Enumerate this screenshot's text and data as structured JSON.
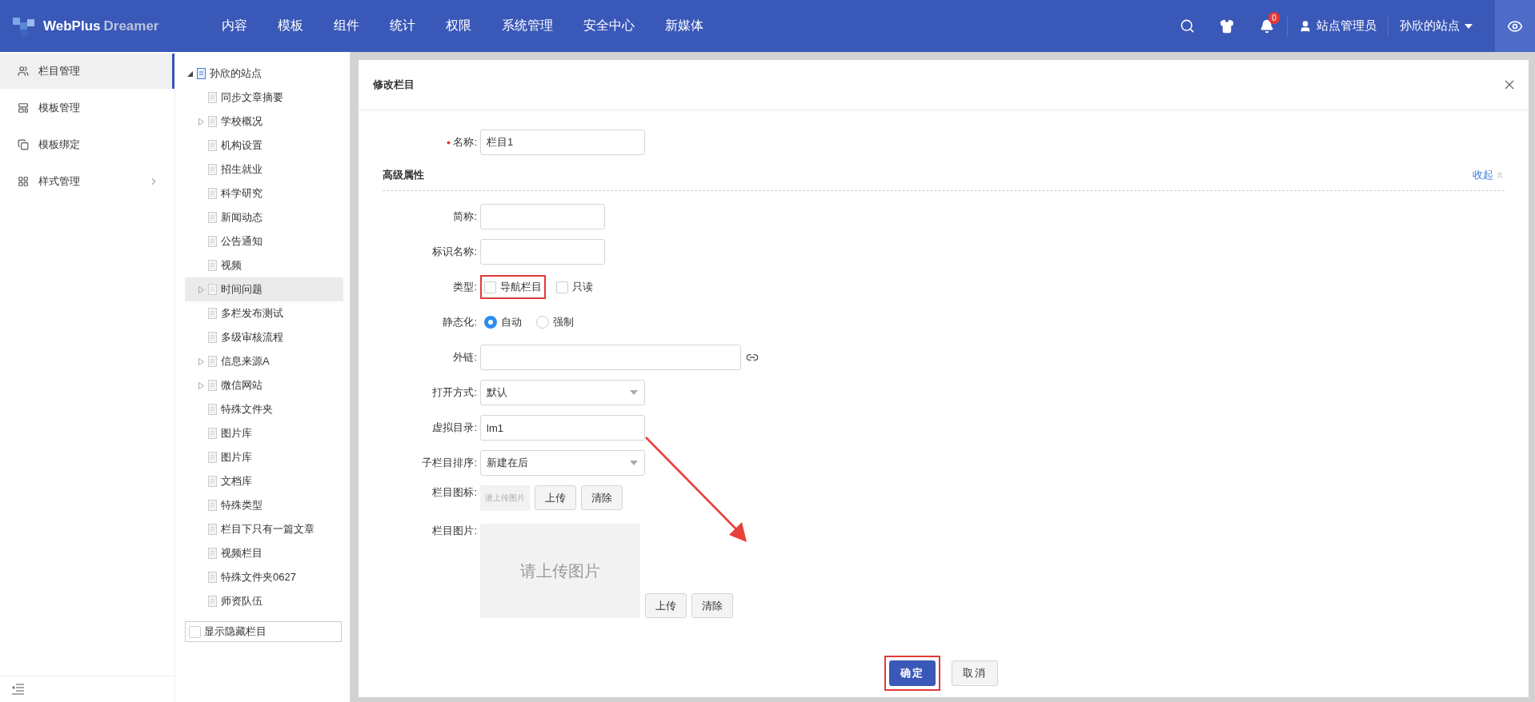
{
  "header": {
    "brand": "WebPlus",
    "product": "Dreamer",
    "nav": [
      {
        "label": "内容"
      },
      {
        "label": "模板"
      },
      {
        "label": "组件"
      },
      {
        "label": "统计"
      },
      {
        "label": "权限"
      },
      {
        "label": "系统管理"
      },
      {
        "label": "安全中心"
      },
      {
        "label": "新媒体"
      }
    ],
    "notification_count": "0",
    "user": "站点管理员",
    "site": "孙欣的站点"
  },
  "sidebar": {
    "items": [
      {
        "label": "栏目管理",
        "selected": true,
        "has_submenu": false
      },
      {
        "label": "模板管理",
        "selected": false,
        "has_submenu": false
      },
      {
        "label": "模板绑定",
        "selected": false,
        "has_submenu": false
      },
      {
        "label": "样式管理",
        "selected": false,
        "has_submenu": true
      }
    ]
  },
  "tree": {
    "root": {
      "label": "孙欣的站点",
      "expanded": true
    },
    "children": [
      {
        "label": "同步文章摘要",
        "expandable": false,
        "selected": false
      },
      {
        "label": "学校概况",
        "expandable": true,
        "selected": false
      },
      {
        "label": "机构设置",
        "expandable": false,
        "selected": false
      },
      {
        "label": "招生就业",
        "expandable": false,
        "selected": false
      },
      {
        "label": "科学研究",
        "expandable": false,
        "selected": false
      },
      {
        "label": "新闻动态",
        "expandable": false,
        "selected": false
      },
      {
        "label": "公告通知",
        "expandable": false,
        "selected": false
      },
      {
        "label": "视频",
        "expandable": false,
        "selected": false
      },
      {
        "label": "时间问题",
        "expandable": true,
        "selected": true
      },
      {
        "label": "多栏发布测试",
        "expandable": false,
        "selected": false
      },
      {
        "label": "多级审核流程",
        "expandable": false,
        "selected": false
      },
      {
        "label": "信息来源A",
        "expandable": true,
        "selected": false
      },
      {
        "label": "微信网站",
        "expandable": true,
        "selected": false
      },
      {
        "label": "特殊文件夹",
        "expandable": false,
        "selected": false
      },
      {
        "label": "图片库",
        "expandable": false,
        "selected": false
      },
      {
        "label": "图片库",
        "expandable": false,
        "selected": false
      },
      {
        "label": "文档库",
        "expandable": false,
        "selected": false
      },
      {
        "label": "特殊类型",
        "expandable": false,
        "selected": false
      },
      {
        "label": "栏目下只有一篇文章",
        "expandable": false,
        "selected": false
      },
      {
        "label": "视频栏目",
        "expandable": false,
        "selected": false
      },
      {
        "label": "特殊文件夹0627",
        "expandable": false,
        "selected": false
      },
      {
        "label": "师资队伍",
        "expandable": false,
        "selected": false
      }
    ],
    "show_hidden": {
      "label": "显示隐藏栏目",
      "checked": false
    }
  },
  "dialog": {
    "title": "修改栏目",
    "fields": [
      {
        "kind": "text",
        "label": "名称:",
        "required": true,
        "value": "栏目1"
      }
    ],
    "section": {
      "title": "高级属性",
      "toggle": "收起",
      "fields": [
        {
          "kind": "text-short",
          "label": "简称:"
        },
        {
          "kind": "text-short",
          "label": "标识名称:"
        },
        {
          "kind": "checkboxes",
          "label": "类型:",
          "options": [
            {
              "label": "导航栏目",
              "checked": false,
              "highlighted": true
            },
            {
              "label": "只读",
              "checked": false,
              "highlighted": false
            }
          ]
        },
        {
          "kind": "radios",
          "label": "静态化:",
          "options": [
            {
              "label": "自动",
              "selected": true
            },
            {
              "label": "强制",
              "selected": false
            }
          ]
        },
        {
          "kind": "link",
          "label": "外链:"
        },
        {
          "kind": "select",
          "label": "打开方式:",
          "value": "默认"
        },
        {
          "kind": "text",
          "label": "虚拟目录:",
          "value": "lm1"
        },
        {
          "kind": "select",
          "label": "子栏目排序:",
          "value": "新建在后"
        },
        {
          "kind": "icon-upload",
          "label": "栏目图标:",
          "placeholder": "请上传图片",
          "buttons": [
            "上传",
            "清除"
          ]
        },
        {
          "kind": "image-upload",
          "label": "栏目图片:",
          "placeholder": "请上传图片",
          "buttons": [
            "上传",
            "清除"
          ]
        }
      ]
    },
    "buttons": [
      {
        "label": "确定",
        "primary": true,
        "highlighted": true
      },
      {
        "label": "取消",
        "primary": false,
        "highlighted": false
      }
    ],
    "annotation_arrow": true
  }
}
